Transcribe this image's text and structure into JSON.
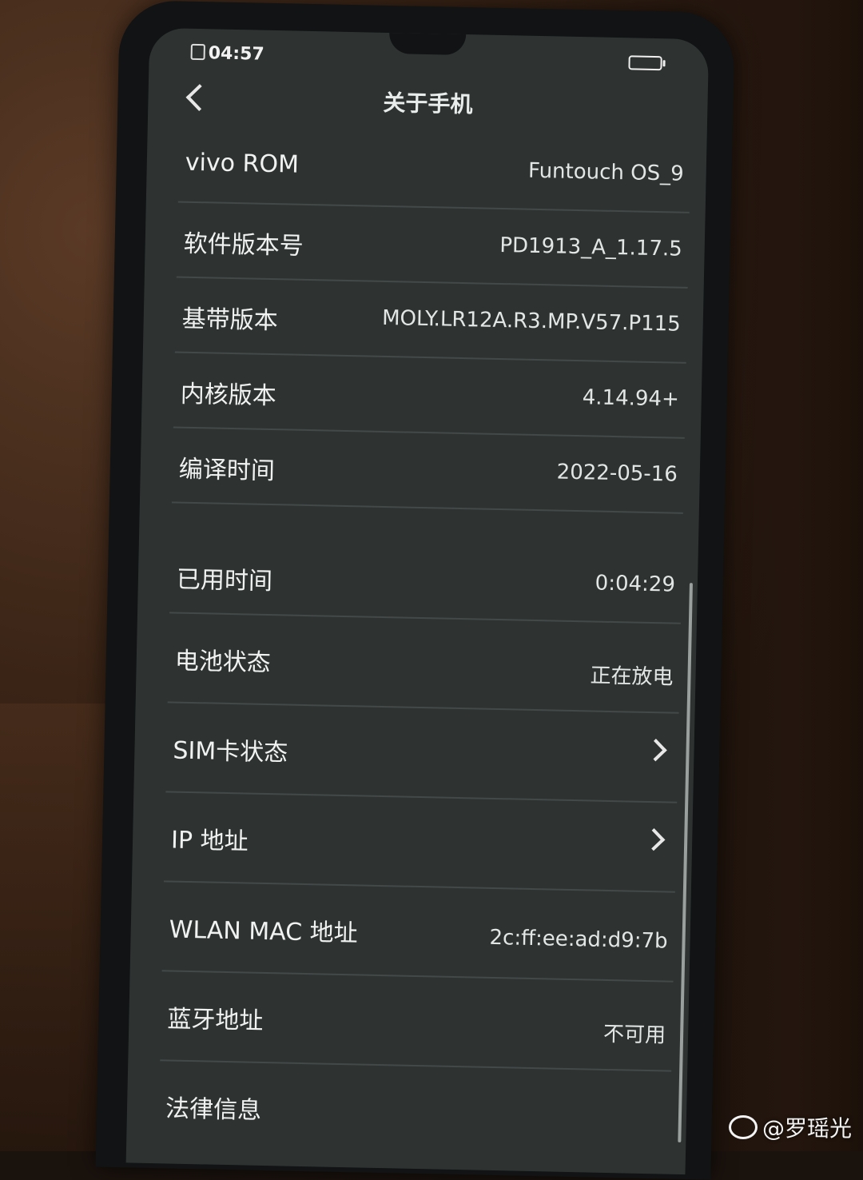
{
  "status_bar": {
    "time": "04:57"
  },
  "header": {
    "title": "关于手机"
  },
  "rows": [
    {
      "label": "vivo ROM",
      "value": "Funtouch OS_9"
    },
    {
      "label": "软件版本号",
      "value": "PD1913_A_1.17.5"
    },
    {
      "label": "基带版本",
      "value": "MOLY.LR12A.R3.MP.V57.P115"
    },
    {
      "label": "内核版本",
      "value": "4.14.94+"
    },
    {
      "label": "编译时间",
      "value": "2022-05-16"
    },
    {
      "label": "已用时间",
      "value": "0:04:29"
    },
    {
      "label": "电池状态",
      "value": "正在放电"
    },
    {
      "label": "SIM卡状态",
      "value": ""
    },
    {
      "label": "IP 地址",
      "value": ""
    },
    {
      "label": "WLAN MAC 地址",
      "value": "2c:ff:ee:ad:d9:7b"
    },
    {
      "label": "蓝牙地址",
      "value": "不可用"
    },
    {
      "label": "法律信息",
      "value": ""
    }
  ],
  "watermark": {
    "text": "@罗瑶光"
  }
}
